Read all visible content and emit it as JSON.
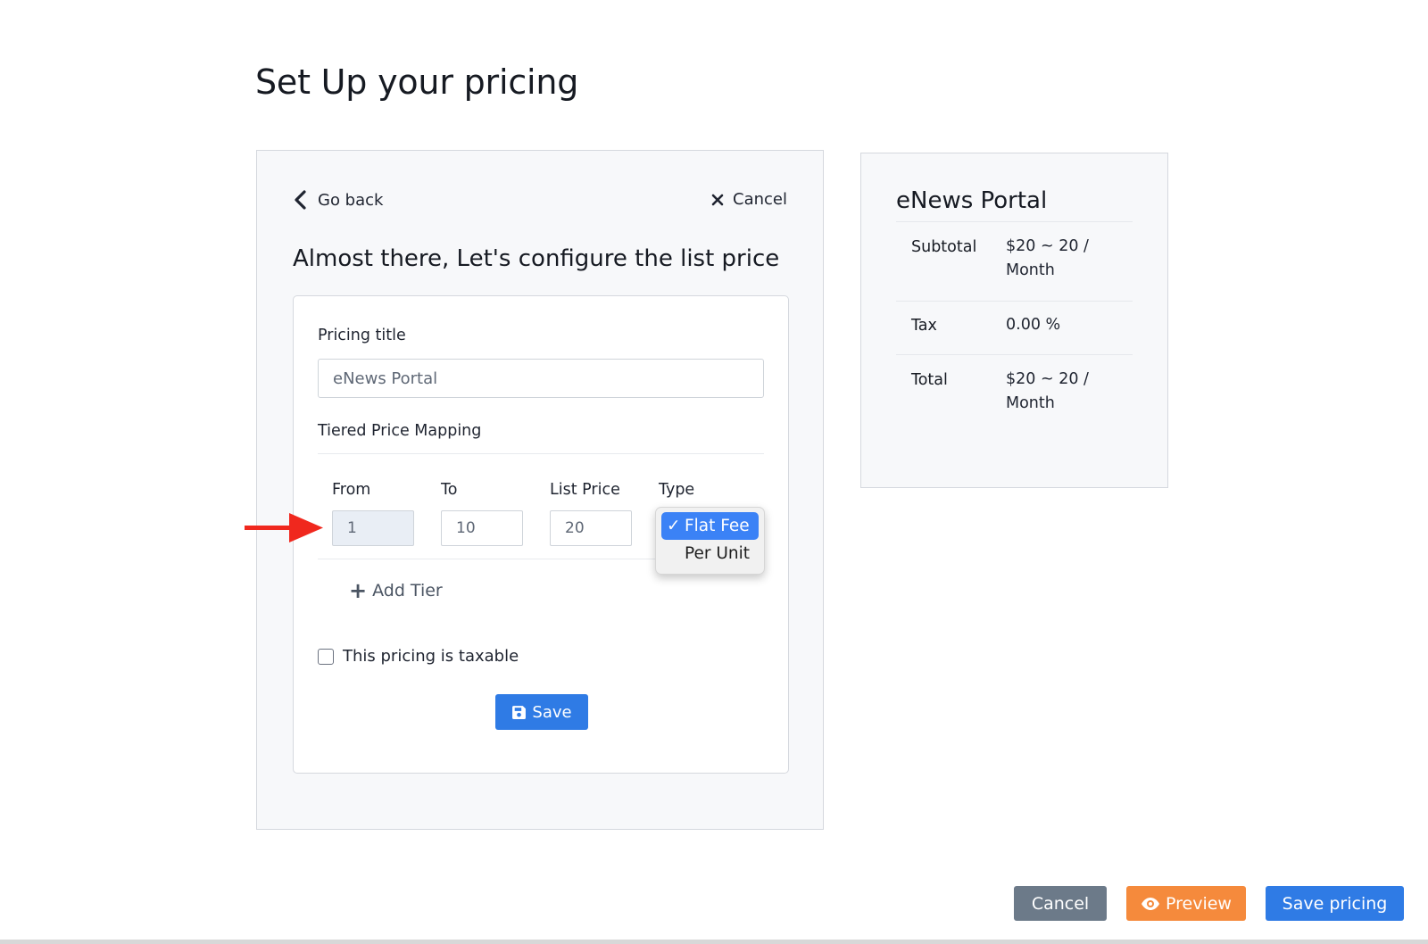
{
  "page": {
    "title": "Set Up your pricing"
  },
  "config": {
    "go_back_label": "Go back",
    "cancel_label": "Cancel",
    "heading": "Almost there, Let's configure the list price",
    "pricing_title_label": "Pricing title",
    "pricing_title_value": "eNews Portal",
    "tiered_label": "Tiered Price Mapping",
    "columns": {
      "from": "From",
      "to": "To",
      "list_price": "List Price",
      "type": "Type"
    },
    "tier": {
      "from": "1",
      "to": "10",
      "list_price": "20"
    },
    "type_options": [
      {
        "label": "Flat Fee",
        "selected": true
      },
      {
        "label": "Per Unit",
        "selected": false
      }
    ],
    "add_tier_label": "Add Tier",
    "taxable_label": "This pricing is taxable",
    "taxable_checked": false,
    "save_label": "Save"
  },
  "summary": {
    "title": "eNews Portal",
    "rows": [
      {
        "label": "Subtotal",
        "value": "$20 ~ 20 / Month"
      },
      {
        "label": "Tax",
        "value": "0.00 %"
      },
      {
        "label": "Total",
        "value": "$20 ~ 20 / Month"
      }
    ]
  },
  "footer": {
    "cancel_label": "Cancel",
    "preview_label": "Preview",
    "save_pricing_label": "Save pricing"
  },
  "colors": {
    "primary": "#2f7be5",
    "preview": "#f58a3c",
    "secondary": "#6c7a89",
    "annotation_arrow": "#f0281e",
    "select_highlight": "#3b82f6"
  }
}
